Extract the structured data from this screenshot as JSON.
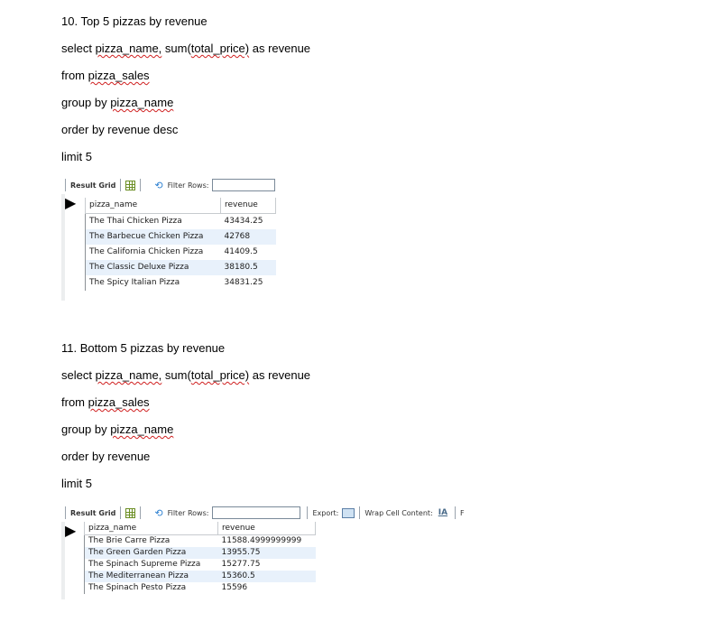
{
  "section1": {
    "heading": "10. Top 5 pizzas by revenue",
    "sql": {
      "select_kw": "select ",
      "select_col": "pizza_name,",
      "select_mid": " sum(",
      "select_arg": "total_price)",
      "select_tail": " as revenue",
      "from_kw": "from ",
      "from_table": "pizza_sales",
      "group_kw": "group by ",
      "group_col": "pizza_name",
      "order": "order by revenue desc",
      "limit": "limit 5"
    },
    "grid": {
      "title": "Result Grid",
      "filter_label": "Filter Rows:",
      "columns": [
        "pizza_name",
        "revenue"
      ],
      "rows": [
        [
          "The Thai Chicken Pizza",
          "43434.25"
        ],
        [
          "The Barbecue Chicken Pizza",
          "42768"
        ],
        [
          "The California Chicken Pizza",
          "41409.5"
        ],
        [
          "The Classic Deluxe Pizza",
          "38180.5"
        ],
        [
          "The Spicy Italian Pizza",
          "34831.25"
        ]
      ]
    }
  },
  "section2": {
    "heading": "11. Bottom 5 pizzas by revenue",
    "sql": {
      "select_kw": "select ",
      "select_col": "pizza_name,",
      "select_mid": " sum(",
      "select_arg": "total_price)",
      "select_tail": " as revenue",
      "from_kw": "from ",
      "from_table": "pizza_sales",
      "group_kw": "group by ",
      "group_col": "pizza_name",
      "order": "order by revenue",
      "limit": "limit 5"
    },
    "grid": {
      "title": "Result Grid",
      "filter_label": "Filter Rows:",
      "export_label": "Export:",
      "wrap_label": "Wrap Cell Content:",
      "trailing": "F",
      "columns": [
        "pizza_name",
        "revenue"
      ],
      "rows": [
        [
          "The Brie Carre Pizza",
          "11588.4999999999"
        ],
        [
          "The Green Garden Pizza",
          "13955.75"
        ],
        [
          "The Spinach Supreme Pizza",
          "15277.75"
        ],
        [
          "The Mediterranean Pizza",
          "15360.5"
        ],
        [
          "The Spinach Pesto Pizza",
          "15596"
        ]
      ]
    }
  },
  "colors": {
    "alt_row": "#e8f1fb",
    "squiggle": "#d02020"
  }
}
